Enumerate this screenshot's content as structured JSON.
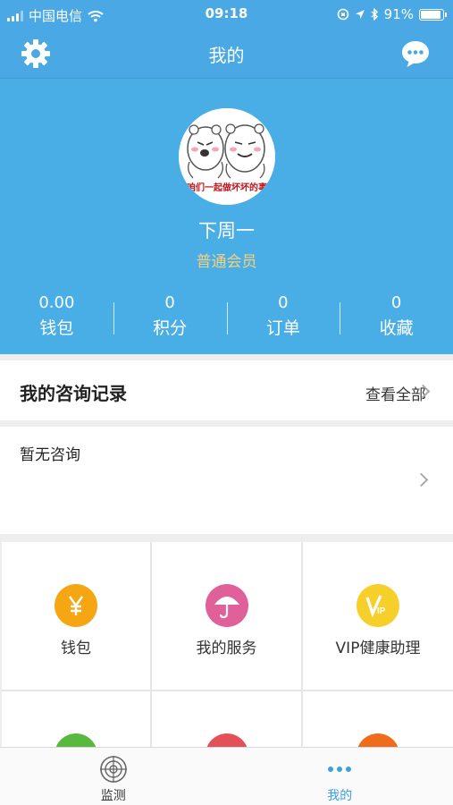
{
  "status_bar": {
    "carrier": "中国电信",
    "time": "09:18",
    "battery": "91%"
  },
  "nav": {
    "title": "我的",
    "left_icon": "gear-icon",
    "right_icon": "chat-bubble-icon"
  },
  "profile": {
    "avatar_caption": "咱们一起做坏坏的事",
    "username": "下周一",
    "member_level": "普通会员",
    "stats": [
      {
        "value": "0.00",
        "label": "钱包"
      },
      {
        "value": "0",
        "label": "积分"
      },
      {
        "value": "0",
        "label": "订单"
      },
      {
        "value": "0",
        "label": "收藏"
      }
    ]
  },
  "consult": {
    "title": "我的咨询记录",
    "view_all": "查看全部",
    "empty_text": "暂无咨询"
  },
  "grid": {
    "items": [
      {
        "label": "钱包",
        "icon": "yen-icon",
        "color": "#f5a612"
      },
      {
        "label": "我的服务",
        "icon": "umbrella-icon",
        "color": "#e0609a"
      },
      {
        "label": "VIP健康助理",
        "icon": "vip-icon",
        "color": "#f7cf2a"
      },
      {
        "label": "",
        "icon": "green-icon",
        "color": "#59b83e"
      },
      {
        "label": "",
        "icon": "red-icon",
        "color": "#e4505a"
      },
      {
        "label": "",
        "icon": "orange-icon",
        "color": "#ee6c1c"
      }
    ]
  },
  "tabs": [
    {
      "label": "监测",
      "icon": "radar-icon",
      "active": false
    },
    {
      "label": "我的",
      "icon": "dots-icon",
      "active": true
    }
  ],
  "colors": {
    "primary": "#4aa8e4",
    "accent_text": "#f2d07e",
    "tab_active": "#3aa0e6"
  }
}
